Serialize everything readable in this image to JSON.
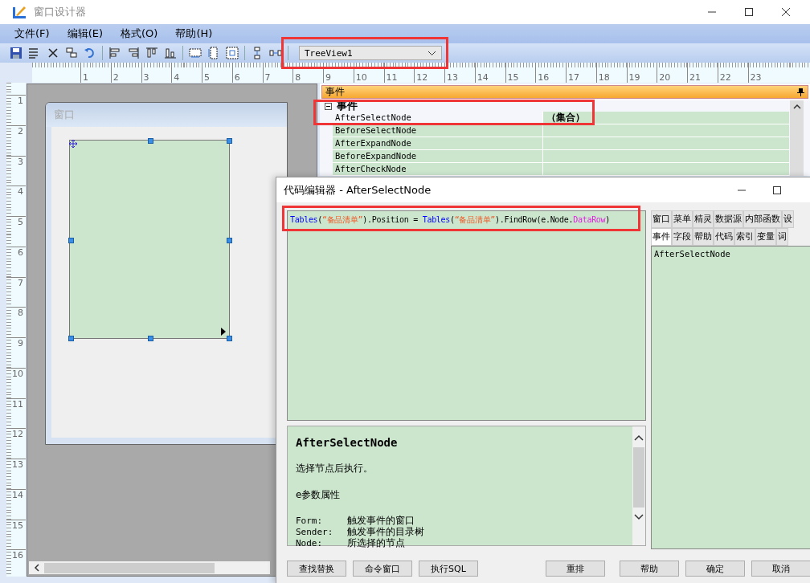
{
  "designer": {
    "title": "窗口设计器",
    "menu": [
      "文件(F)",
      "编辑(E)",
      "格式(O)",
      "帮助(H)"
    ],
    "object_selector": {
      "value": "TreeView1"
    },
    "ruler_h": [
      "1",
      "2",
      "3",
      "4",
      "5",
      "6",
      "7",
      "8",
      "9",
      "10",
      "11",
      "12",
      "13",
      "14",
      "15",
      "16",
      "17",
      "18",
      "19",
      "20",
      "21",
      "22",
      "23"
    ],
    "ruler_v": [
      "1",
      "2",
      "3",
      "4",
      "5",
      "6",
      "7",
      "8",
      "9",
      "10",
      "11",
      "12",
      "13",
      "14",
      "15",
      "16"
    ],
    "form": {
      "title": "窗口"
    }
  },
  "properties": {
    "title": "事件",
    "category": {
      "label": "事件",
      "expanded": true
    },
    "rows": [
      {
        "name": "AfterSelectNode",
        "value": "（集合）",
        "selected": true
      },
      {
        "name": "BeforeSelectNode",
        "value": "",
        "selected": false
      },
      {
        "name": "AfterExpandNode",
        "value": "",
        "selected": false
      },
      {
        "name": "BeforeExpandNode",
        "value": "",
        "selected": false
      },
      {
        "name": "AfterCheckNode",
        "value": "",
        "selected": false
      }
    ]
  },
  "code_editor": {
    "title": "代码编辑器 - AfterSelectNode",
    "code": [
      {
        "kind": "func",
        "text": "Tables"
      },
      {
        "kind": "plain",
        "text": "("
      },
      {
        "kind": "string",
        "text": "“备品清单”"
      },
      {
        "kind": "plain",
        "text": ").Position = "
      },
      {
        "kind": "func",
        "text": "Tables"
      },
      {
        "kind": "plain",
        "text": "("
      },
      {
        "kind": "string",
        "text": "“备品清单”"
      },
      {
        "kind": "plain",
        "text": ").FindRow(e.Node."
      },
      {
        "kind": "member",
        "text": "DataRow"
      },
      {
        "kind": "plain",
        "text": ")"
      }
    ],
    "help": {
      "heading": "AfterSelectNode",
      "summary": "选择节点后执行。",
      "params_title": "e参数属性",
      "params": [
        {
          "name": "Form:",
          "desc": "触发事件的窗口"
        },
        {
          "name": "Sender:",
          "desc": "触发事件的目录树"
        },
        {
          "name": "Node:",
          "desc": "所选择的节点"
        }
      ]
    },
    "tabs_row1": [
      {
        "label": "窗口",
        "selected": false
      },
      {
        "label": "菜单",
        "selected": false
      },
      {
        "label": "精灵",
        "selected": false
      },
      {
        "label": "数据源",
        "selected": false
      },
      {
        "label": "内部函数",
        "selected": false
      },
      {
        "label": "设",
        "selected": false
      }
    ],
    "tabs_row2": [
      {
        "label": "事件",
        "selected": true
      },
      {
        "label": "字段",
        "selected": false
      },
      {
        "label": "帮助",
        "selected": false
      },
      {
        "label": "代码",
        "selected": false
      },
      {
        "label": "索引",
        "selected": false
      },
      {
        "label": "变量",
        "selected": false
      },
      {
        "label": "词",
        "selected": false
      }
    ],
    "list": [
      "AfterSelectNode"
    ],
    "buttons_left": [
      "查找替换",
      "命令窗口",
      "执行SQL"
    ],
    "buttons_right": [
      "重排",
      "帮助",
      "确定",
      "取消"
    ]
  }
}
